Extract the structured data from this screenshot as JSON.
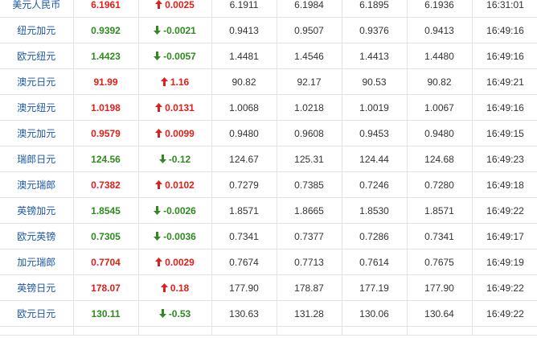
{
  "table": {
    "rows": [
      {
        "name": "美元人民币",
        "price": "6.1961",
        "dir": "up",
        "change": "0.0025",
        "open": "6.1911",
        "high": "6.1984",
        "low": "6.1895",
        "prev": "6.1936",
        "time": "16:31:01"
      },
      {
        "name": "纽元加元",
        "price": "0.9392",
        "dir": "down",
        "change": "-0.0021",
        "open": "0.9413",
        "high": "0.9507",
        "low": "0.9376",
        "prev": "0.9413",
        "time": "16:49:16"
      },
      {
        "name": "欧元纽元",
        "price": "1.4423",
        "dir": "down",
        "change": "-0.0057",
        "open": "1.4481",
        "high": "1.4546",
        "low": "1.4413",
        "prev": "1.4480",
        "time": "16:49:16"
      },
      {
        "name": "澳元日元",
        "price": "91.99",
        "dir": "up",
        "change": "1.16",
        "open": "90.82",
        "high": "92.17",
        "low": "90.53",
        "prev": "90.82",
        "time": "16:49:21"
      },
      {
        "name": "澳元纽元",
        "price": "1.0198",
        "dir": "up",
        "change": "0.0131",
        "open": "1.0068",
        "high": "1.0218",
        "low": "1.0019",
        "prev": "1.0067",
        "time": "16:49:16"
      },
      {
        "name": "澳元加元",
        "price": "0.9579",
        "dir": "up",
        "change": "0.0099",
        "open": "0.9480",
        "high": "0.9608",
        "low": "0.9453",
        "prev": "0.9480",
        "time": "16:49:15"
      },
      {
        "name": "瑞郎日元",
        "price": "124.56",
        "dir": "down",
        "change": "-0.12",
        "open": "124.67",
        "high": "125.31",
        "low": "124.44",
        "prev": "124.68",
        "time": "16:49:23"
      },
      {
        "name": "澳元瑞郎",
        "price": "0.7382",
        "dir": "up",
        "change": "0.0102",
        "open": "0.7279",
        "high": "0.7385",
        "low": "0.7246",
        "prev": "0.7280",
        "time": "16:49:18"
      },
      {
        "name": "英镑加元",
        "price": "1.8545",
        "dir": "down",
        "change": "-0.0026",
        "open": "1.8571",
        "high": "1.8665",
        "low": "1.8530",
        "prev": "1.8571",
        "time": "16:49:22"
      },
      {
        "name": "欧元英镑",
        "price": "0.7305",
        "dir": "down",
        "change": "-0.0036",
        "open": "0.7341",
        "high": "0.7377",
        "low": "0.7286",
        "prev": "0.7341",
        "time": "16:49:17"
      },
      {
        "name": "加元瑞郎",
        "price": "0.7704",
        "dir": "up",
        "change": "0.0029",
        "open": "0.7674",
        "high": "0.7713",
        "low": "0.7614",
        "prev": "0.7675",
        "time": "16:49:19"
      },
      {
        "name": "英镑日元",
        "price": "178.07",
        "dir": "up",
        "change": "0.18",
        "open": "177.90",
        "high": "178.87",
        "low": "177.19",
        "prev": "177.90",
        "time": "16:49:22"
      },
      {
        "name": "欧元日元",
        "price": "130.11",
        "dir": "down",
        "change": "-0.53",
        "open": "130.63",
        "high": "131.28",
        "low": "130.06",
        "prev": "130.64",
        "time": "16:49:22"
      }
    ]
  },
  "colors": {
    "up": "#e0201a",
    "down": "#2e8b1e",
    "name_link": "#1a56a8",
    "border": "#e3e3e3"
  },
  "icons": {
    "up": "arrow-up-icon",
    "down": "arrow-down-icon"
  }
}
